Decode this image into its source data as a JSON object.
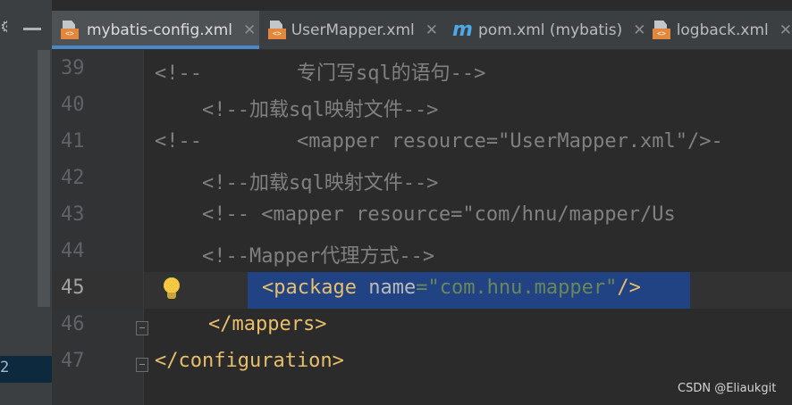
{
  "left_panel": {
    "selected_row_number": "2"
  },
  "tabs": [
    {
      "label": "mybatis-config.xml",
      "icon": "xml-file-icon",
      "active": true,
      "close": "✕"
    },
    {
      "label": "UserMapper.xml",
      "icon": "xml-file-icon",
      "active": false,
      "close": "✕"
    },
    {
      "label": "pom.xml (mybatis)",
      "icon": "maven-icon",
      "active": false,
      "close": "✕"
    },
    {
      "label": "logback.xml",
      "icon": "xml-file-icon",
      "active": false,
      "close": "✕"
    }
  ],
  "editor": {
    "current_line": "45",
    "line_numbers": [
      "39",
      "40",
      "41",
      "42",
      "43",
      "44",
      "45",
      "46",
      "47"
    ],
    "lines": [
      {
        "prefix": "<!--",
        "text": "        专门写sql的语句-->"
      },
      {
        "text": "    <!--加载sql映射文件-->"
      },
      {
        "prefix": "<!--",
        "text": "        <mapper resource=\"UserMapper.xml\"/>-"
      },
      {
        "text": "    <!--加载sql映射文件-->"
      },
      {
        "text": "    <!-- <mapper resource=\"com/hnu/mapper/Us"
      },
      {
        "text": "    <!--Mapper代理方式-->"
      },
      {
        "open": "<package ",
        "attr": "name",
        "eq": "=",
        "val": "\"com.hnu.mapper\"",
        "close": "/>"
      },
      {
        "text": "</mappers>"
      },
      {
        "text": "</configuration>"
      }
    ]
  },
  "watermark": "CSDN @Eliaukgit",
  "colors": {
    "selection": "#214283",
    "tag": "#e8bf6a",
    "string": "#6a8759",
    "comment": "#808080",
    "accent": "#4a88c7"
  }
}
